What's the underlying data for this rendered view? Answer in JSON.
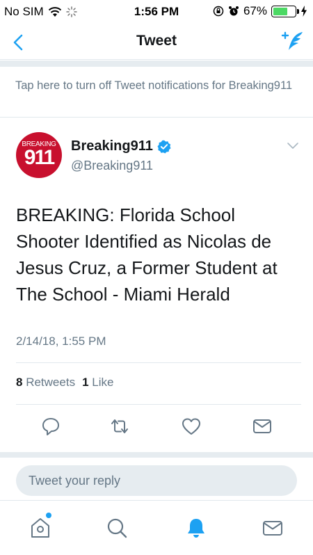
{
  "status_bar": {
    "carrier": "No SIM",
    "time": "1:56 PM",
    "battery_percent": "67%",
    "battery_level": 0.67,
    "icons": [
      "wifi-icon",
      "loading-spinner-icon",
      "orientation-lock-icon",
      "alarm-icon",
      "battery-icon",
      "charging-bolt-icon"
    ]
  },
  "nav": {
    "title": "Tweet",
    "back_icon": "chevron-left-icon",
    "compose_icon": "compose-tweet-icon"
  },
  "notification_banner": {
    "text": "Tap here to turn off Tweet notifications for Breaking911"
  },
  "tweet": {
    "avatar_text_top": "BREAKING",
    "avatar_text_big": "911",
    "display_name": "Breaking911",
    "verified": true,
    "handle": "@Breaking911",
    "body": "BREAKING: Florida School Shooter Identified as Nicolas de Jesus Cruz, a Former Student at The School - Miami Herald",
    "timestamp": "2/14/18, 1:55 PM",
    "retweet_count": "8",
    "retweet_label": "Retweets",
    "like_count": "1",
    "like_label": "Like"
  },
  "actions": [
    "reply-icon",
    "retweet-icon",
    "like-icon",
    "direct-message-icon"
  ],
  "reply": {
    "placeholder": "Tweet your reply"
  },
  "tab_bar": {
    "tabs": [
      "home-icon",
      "search-icon",
      "notifications-icon",
      "messages-icon"
    ],
    "active": "notifications-icon"
  },
  "colors": {
    "accent": "#1da1f2",
    "text_primary": "#14171a",
    "text_secondary": "#657786",
    "divider": "#e1e8ed",
    "background_gray": "#e6ecf0",
    "avatar_red": "#c8102e",
    "battery_green": "#4cd964"
  }
}
